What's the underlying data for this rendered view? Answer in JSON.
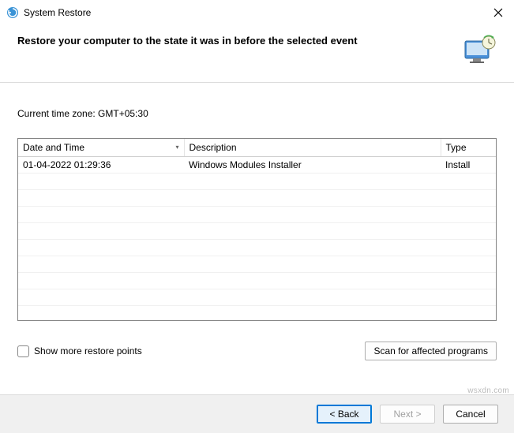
{
  "window": {
    "title": "System Restore"
  },
  "header": {
    "heading": "Restore your computer to the state it was in before the selected event"
  },
  "timezone_label": "Current time zone: GMT+05:30",
  "table": {
    "columns": {
      "date": "Date and Time",
      "desc": "Description",
      "type": "Type"
    },
    "rows": [
      {
        "date": "01-04-2022 01:29:36",
        "desc": "Windows Modules Installer",
        "type": "Install"
      }
    ]
  },
  "show_more_label": "Show more restore points",
  "scan_button": "Scan for affected programs",
  "footer": {
    "back": "< Back",
    "next": "Next >",
    "cancel": "Cancel"
  },
  "watermark": "wsxdn.com"
}
